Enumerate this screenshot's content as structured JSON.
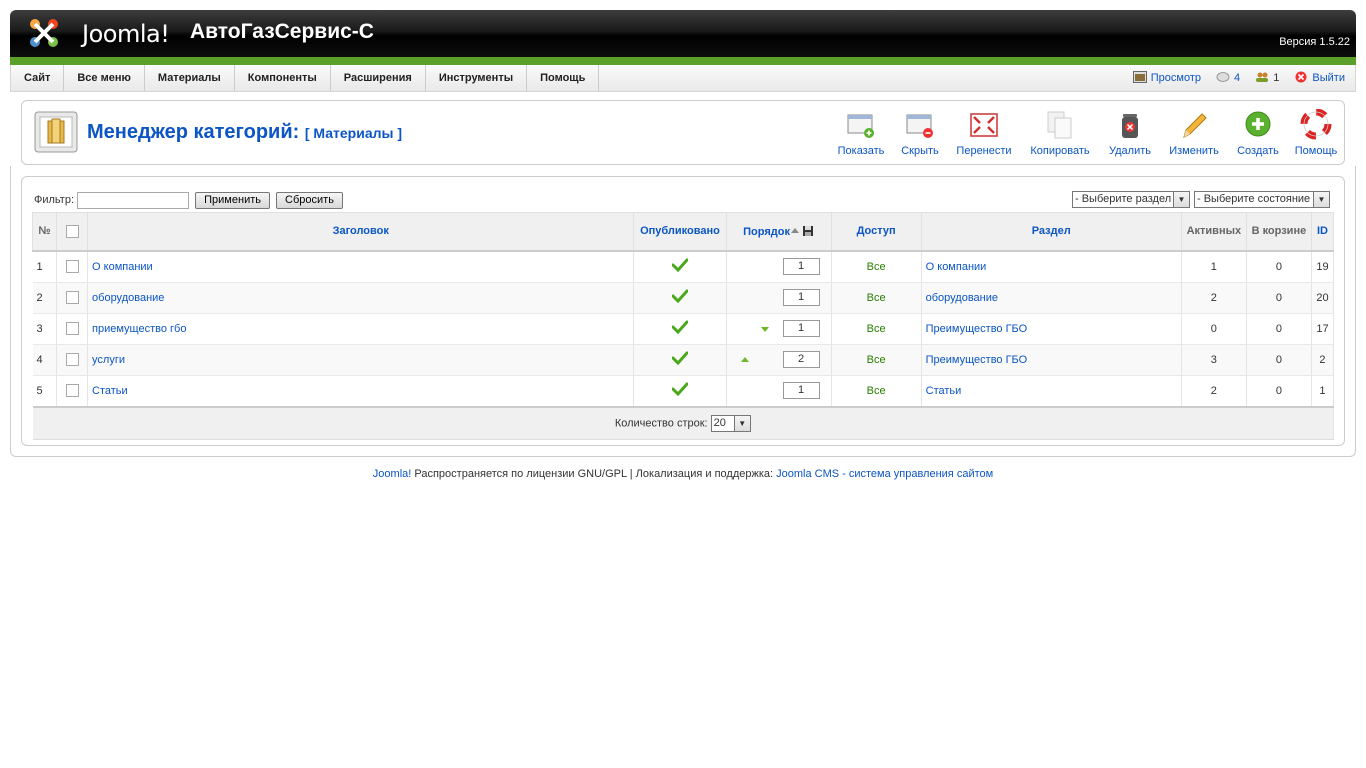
{
  "header": {
    "logo_text": "Joomla!",
    "site_title": "АвтоГазСервис-С",
    "version": "Версия 1.5.22"
  },
  "menu": {
    "items": [
      "Сайт",
      "Все меню",
      "Материалы",
      "Компоненты",
      "Расширения",
      "Инструменты",
      "Помощь"
    ]
  },
  "status": {
    "preview": "Просмотр",
    "messages": "4",
    "users": "1",
    "logout": "Выйти"
  },
  "toolbar": {
    "title": "Менеджер категорий:",
    "subtitle": "[ Материалы ]",
    "buttons": [
      {
        "label": "Показать",
        "icon": "publish-icon"
      },
      {
        "label": "Скрыть",
        "icon": "unpublish-icon"
      },
      {
        "label": "Перенести",
        "icon": "move-icon"
      },
      {
        "label": "Копировать",
        "icon": "copy-icon"
      },
      {
        "label": "Удалить",
        "icon": "delete-icon"
      },
      {
        "label": "Изменить",
        "icon": "edit-icon"
      },
      {
        "label": "Создать",
        "icon": "new-icon"
      },
      {
        "label": "Помощь",
        "icon": "help-icon"
      }
    ]
  },
  "filter": {
    "label": "Фильтр:",
    "value": "",
    "apply": "Применить",
    "reset": "Сбросить",
    "section_select": "- Выберите раздел -",
    "state_select": "- Выберите состояние -"
  },
  "table": {
    "headers": {
      "num": "№",
      "title": "Заголовок",
      "published": "Опубликовано",
      "order": "Порядок",
      "access": "Доступ",
      "section": "Раздел",
      "active": "Активных",
      "trash": "В корзине",
      "id": "ID"
    },
    "rows": [
      {
        "num": "1",
        "title": "О компании",
        "order": "1",
        "access": "Все",
        "section": "О компании",
        "active": "1",
        "trash": "0",
        "id": "19",
        "up": false,
        "down": false
      },
      {
        "num": "2",
        "title": "оборудование",
        "order": "1",
        "access": "Все",
        "section": "оборудование",
        "active": "2",
        "trash": "0",
        "id": "20",
        "up": false,
        "down": false
      },
      {
        "num": "3",
        "title": "приемущество гбо",
        "order": "1",
        "access": "Все",
        "section": "Преимущество ГБО",
        "active": "0",
        "trash": "0",
        "id": "17",
        "up": false,
        "down": true
      },
      {
        "num": "4",
        "title": "услуги",
        "order": "2",
        "access": "Все",
        "section": "Преимущество ГБО",
        "active": "3",
        "trash": "0",
        "id": "2",
        "up": true,
        "down": false
      },
      {
        "num": "5",
        "title": "Статьи",
        "order": "1",
        "access": "Все",
        "section": "Статьи",
        "active": "2",
        "trash": "0",
        "id": "1",
        "up": false,
        "down": false
      }
    ],
    "limit_label": "Количество строк:",
    "limit_value": "20"
  },
  "footer": {
    "joomla_link": "Joomla!",
    "license_text": " Распространяется по лицензии GNU/GPL | Локализация и поддержка: ",
    "support_link": "Joomla CMS - система управления сайтом"
  },
  "colors": {
    "accent_green": "#5aa028",
    "link_blue": "#0b55c4"
  }
}
